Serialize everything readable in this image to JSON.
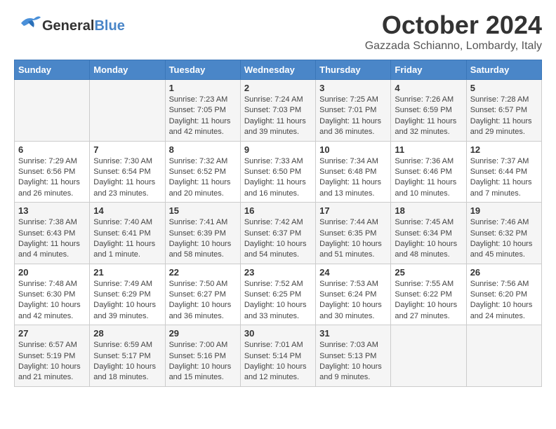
{
  "header": {
    "logo_line1": "General",
    "logo_line2": "Blue",
    "title": "October 2024",
    "location": "Gazzada Schianno, Lombardy, Italy"
  },
  "weekdays": [
    "Sunday",
    "Monday",
    "Tuesday",
    "Wednesday",
    "Thursday",
    "Friday",
    "Saturday"
  ],
  "weeks": [
    [
      {
        "day": "",
        "content": ""
      },
      {
        "day": "",
        "content": ""
      },
      {
        "day": "1",
        "content": "Sunrise: 7:23 AM\nSunset: 7:05 PM\nDaylight: 11 hours and 42 minutes."
      },
      {
        "day": "2",
        "content": "Sunrise: 7:24 AM\nSunset: 7:03 PM\nDaylight: 11 hours and 39 minutes."
      },
      {
        "day": "3",
        "content": "Sunrise: 7:25 AM\nSunset: 7:01 PM\nDaylight: 11 hours and 36 minutes."
      },
      {
        "day": "4",
        "content": "Sunrise: 7:26 AM\nSunset: 6:59 PM\nDaylight: 11 hours and 32 minutes."
      },
      {
        "day": "5",
        "content": "Sunrise: 7:28 AM\nSunset: 6:57 PM\nDaylight: 11 hours and 29 minutes."
      }
    ],
    [
      {
        "day": "6",
        "content": "Sunrise: 7:29 AM\nSunset: 6:56 PM\nDaylight: 11 hours and 26 minutes."
      },
      {
        "day": "7",
        "content": "Sunrise: 7:30 AM\nSunset: 6:54 PM\nDaylight: 11 hours and 23 minutes."
      },
      {
        "day": "8",
        "content": "Sunrise: 7:32 AM\nSunset: 6:52 PM\nDaylight: 11 hours and 20 minutes."
      },
      {
        "day": "9",
        "content": "Sunrise: 7:33 AM\nSunset: 6:50 PM\nDaylight: 11 hours and 16 minutes."
      },
      {
        "day": "10",
        "content": "Sunrise: 7:34 AM\nSunset: 6:48 PM\nDaylight: 11 hours and 13 minutes."
      },
      {
        "day": "11",
        "content": "Sunrise: 7:36 AM\nSunset: 6:46 PM\nDaylight: 11 hours and 10 minutes."
      },
      {
        "day": "12",
        "content": "Sunrise: 7:37 AM\nSunset: 6:44 PM\nDaylight: 11 hours and 7 minutes."
      }
    ],
    [
      {
        "day": "13",
        "content": "Sunrise: 7:38 AM\nSunset: 6:43 PM\nDaylight: 11 hours and 4 minutes."
      },
      {
        "day": "14",
        "content": "Sunrise: 7:40 AM\nSunset: 6:41 PM\nDaylight: 11 hours and 1 minute."
      },
      {
        "day": "15",
        "content": "Sunrise: 7:41 AM\nSunset: 6:39 PM\nDaylight: 10 hours and 58 minutes."
      },
      {
        "day": "16",
        "content": "Sunrise: 7:42 AM\nSunset: 6:37 PM\nDaylight: 10 hours and 54 minutes."
      },
      {
        "day": "17",
        "content": "Sunrise: 7:44 AM\nSunset: 6:35 PM\nDaylight: 10 hours and 51 minutes."
      },
      {
        "day": "18",
        "content": "Sunrise: 7:45 AM\nSunset: 6:34 PM\nDaylight: 10 hours and 48 minutes."
      },
      {
        "day": "19",
        "content": "Sunrise: 7:46 AM\nSunset: 6:32 PM\nDaylight: 10 hours and 45 minutes."
      }
    ],
    [
      {
        "day": "20",
        "content": "Sunrise: 7:48 AM\nSunset: 6:30 PM\nDaylight: 10 hours and 42 minutes."
      },
      {
        "day": "21",
        "content": "Sunrise: 7:49 AM\nSunset: 6:29 PM\nDaylight: 10 hours and 39 minutes."
      },
      {
        "day": "22",
        "content": "Sunrise: 7:50 AM\nSunset: 6:27 PM\nDaylight: 10 hours and 36 minutes."
      },
      {
        "day": "23",
        "content": "Sunrise: 7:52 AM\nSunset: 6:25 PM\nDaylight: 10 hours and 33 minutes."
      },
      {
        "day": "24",
        "content": "Sunrise: 7:53 AM\nSunset: 6:24 PM\nDaylight: 10 hours and 30 minutes."
      },
      {
        "day": "25",
        "content": "Sunrise: 7:55 AM\nSunset: 6:22 PM\nDaylight: 10 hours and 27 minutes."
      },
      {
        "day": "26",
        "content": "Sunrise: 7:56 AM\nSunset: 6:20 PM\nDaylight: 10 hours and 24 minutes."
      }
    ],
    [
      {
        "day": "27",
        "content": "Sunrise: 6:57 AM\nSunset: 5:19 PM\nDaylight: 10 hours and 21 minutes."
      },
      {
        "day": "28",
        "content": "Sunrise: 6:59 AM\nSunset: 5:17 PM\nDaylight: 10 hours and 18 minutes."
      },
      {
        "day": "29",
        "content": "Sunrise: 7:00 AM\nSunset: 5:16 PM\nDaylight: 10 hours and 15 minutes."
      },
      {
        "day": "30",
        "content": "Sunrise: 7:01 AM\nSunset: 5:14 PM\nDaylight: 10 hours and 12 minutes."
      },
      {
        "day": "31",
        "content": "Sunrise: 7:03 AM\nSunset: 5:13 PM\nDaylight: 10 hours and 9 minutes."
      },
      {
        "day": "",
        "content": ""
      },
      {
        "day": "",
        "content": ""
      }
    ]
  ]
}
